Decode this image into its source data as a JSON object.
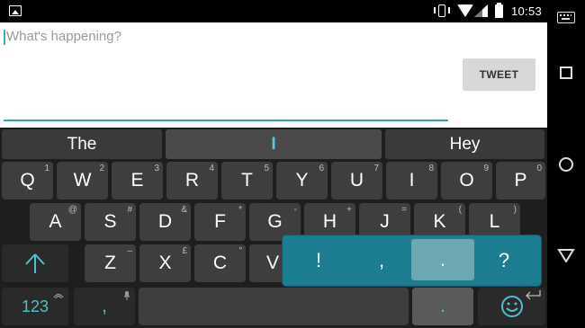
{
  "status_bar": {
    "time": "10:53"
  },
  "compose": {
    "placeholder": "What's happening?",
    "tweet_label": "TWEET"
  },
  "suggestions": [
    "The",
    "I",
    "Hey"
  ],
  "rows": {
    "row1": [
      {
        "k": "Q",
        "s": "1"
      },
      {
        "k": "W",
        "s": "2"
      },
      {
        "k": "E",
        "s": "3"
      },
      {
        "k": "R",
        "s": "4"
      },
      {
        "k": "T",
        "s": "5"
      },
      {
        "k": "Y",
        "s": "6"
      },
      {
        "k": "U",
        "s": "7"
      },
      {
        "k": "I",
        "s": "8"
      },
      {
        "k": "O",
        "s": "9"
      },
      {
        "k": "P",
        "s": "0"
      }
    ],
    "row2": [
      {
        "k": "A",
        "s": "@"
      },
      {
        "k": "S",
        "s": "#"
      },
      {
        "k": "D",
        "s": "&"
      },
      {
        "k": "F",
        "s": "*"
      },
      {
        "k": "G",
        "s": "-"
      },
      {
        "k": "H",
        "s": "+"
      },
      {
        "k": "J",
        "s": "="
      },
      {
        "k": "K",
        "s": "("
      },
      {
        "k": "L",
        "s": ")"
      }
    ],
    "row3": [
      {
        "k": "Z",
        "s": "–"
      },
      {
        "k": "X",
        "s": "£"
      },
      {
        "k": "C",
        "s": "\""
      },
      {
        "k": "V",
        "s": ""
      }
    ]
  },
  "bottom_row": {
    "symbols": "123",
    "comma": ",",
    "period": "."
  },
  "punctuation_popup": [
    "!",
    ",",
    ".",
    "?"
  ],
  "colors": {
    "accent": "#35a7a3",
    "popup": "#1b7d8f",
    "suggestion_highlight": "#57c8d6"
  }
}
